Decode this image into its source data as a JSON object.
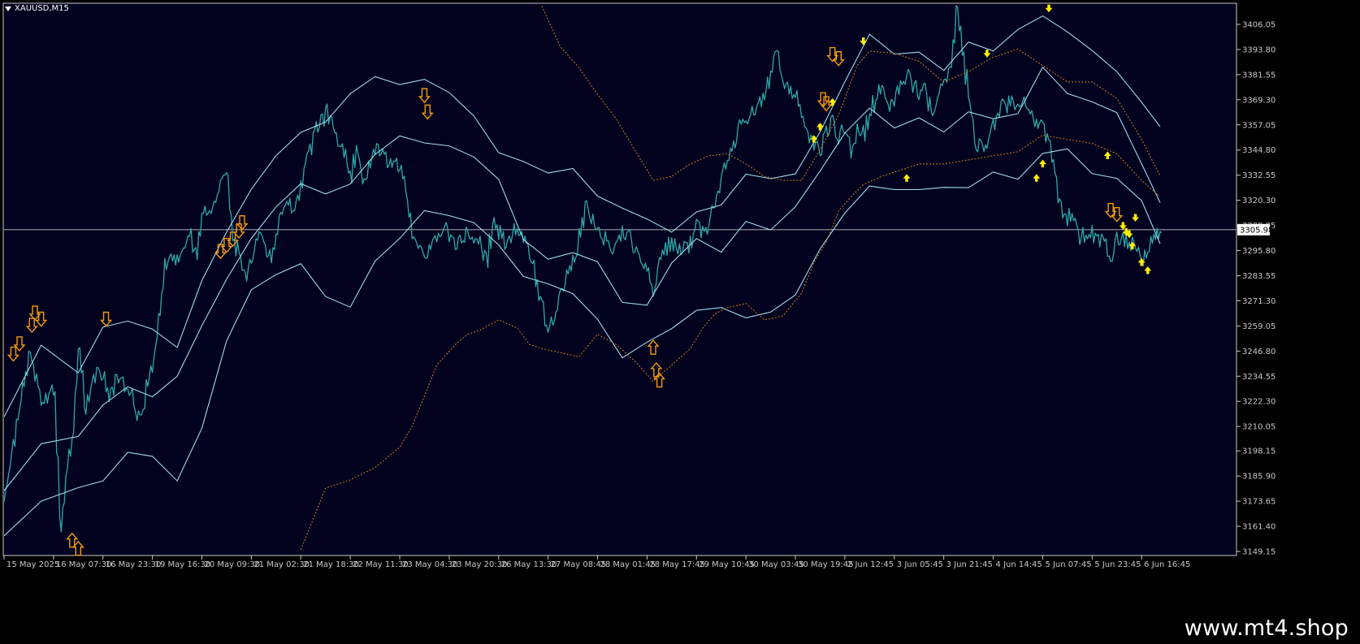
{
  "window": {
    "symbol_label": "XAUUSD,M15"
  },
  "watermark": "www.mt4.shop",
  "colors": {
    "background": "#000000",
    "plot_bg": "#02021f",
    "axis": "#c8c8c8",
    "price_line": "#2ea8a8",
    "band": "#9fdcec",
    "dotted": "#d27c12",
    "arrow_orange": "#f59a0c",
    "arrow_yellow": "#ffee00",
    "hline": "#c8c8c8"
  },
  "chart_data": {
    "type": "line",
    "title": "XAUUSD,M15",
    "ylim": [
      3146,
      3415
    ],
    "y_ticks": [
      "3406.05",
      "3393.80",
      "3381.55",
      "3369.30",
      "3357.05",
      "3344.80",
      "3332.55",
      "3320.30",
      "3308.05",
      "3295.80",
      "3283.55",
      "3271.30",
      "3259.05",
      "3246.80",
      "3234.55",
      "3222.30",
      "3210.05",
      "3198.15",
      "3185.90",
      "3173.65",
      "3161.40",
      "3149.15"
    ],
    "current_price": "3305.98",
    "x_ticks": [
      "15 May 2025",
      "16 May 07:30",
      "16 May 23:30",
      "19 May 16:30",
      "20 May 09:30",
      "21 May 02:30",
      "21 May 18:30",
      "22 May 11:30",
      "23 May 04:30",
      "23 May 20:30",
      "26 May 13:30",
      "27 May 08:45",
      "28 May 01:45",
      "28 May 17:45",
      "29 May 10:45",
      "30 May 03:45",
      "30 May 19:45",
      "2 Jun 12:45",
      "3 Jun 05:45",
      "3 Jun 21:45",
      "4 Jun 14:45",
      "5 Jun 07:45",
      "5 Jun 23:45",
      "6 Jun 16:45"
    ],
    "x_tick_index": [
      0,
      16,
      32,
      48,
      64,
      80,
      96,
      112,
      128,
      144,
      160,
      176,
      192,
      208,
      224,
      240,
      256,
      272,
      288,
      304,
      320,
      336,
      352,
      368
    ],
    "n_points": 375,
    "series": [
      {
        "key": "price",
        "x": [
          0,
          8,
          12,
          16,
          18,
          20,
          22,
          24,
          26,
          30,
          34,
          36,
          40,
          44,
          46,
          48,
          52,
          58,
          60,
          62,
          64,
          68,
          72,
          74,
          78,
          82,
          86,
          90,
          94,
          96,
          100,
          104,
          108,
          112,
          114,
          116,
          120,
          124,
          128,
          130,
          132,
          134,
          136,
          140,
          142,
          146,
          150,
          154,
          156,
          158,
          162,
          166,
          170,
          172,
          176,
          180,
          184,
          188,
          192,
          196,
          200,
          204,
          208,
          210,
          212,
          216,
          220,
          224,
          226,
          230,
          234,
          238,
          242,
          246,
          248,
          250,
          252,
          256,
          258,
          260,
          264,
          266,
          268,
          270,
          272,
          274,
          276,
          278,
          280,
          284,
          286,
          288,
          292,
          296,
          298,
          300,
          302,
          306,
          308,
          312,
          314,
          318,
          320,
          322,
          326,
          330,
          332,
          336,
          338,
          340,
          342,
          344,
          346,
          348,
          350,
          354,
          358,
          360,
          364,
          366,
          368,
          370,
          372,
          374
        ],
        "y": [
          3176,
          3247,
          3222,
          3228,
          3163,
          3185,
          3205,
          3248,
          3218,
          3239,
          3226,
          3232,
          3228,
          3212,
          3232,
          3240,
          3288,
          3296,
          3304,
          3294,
          3312,
          3320,
          3333,
          3300,
          3283,
          3305,
          3293,
          3316,
          3318,
          3330,
          3351,
          3364,
          3350,
          3332,
          3345,
          3331,
          3346,
          3339,
          3338,
          3322,
          3305,
          3298,
          3293,
          3302,
          3308,
          3297,
          3306,
          3300,
          3290,
          3310,
          3300,
          3307,
          3294,
          3280,
          3255,
          3275,
          3290,
          3317,
          3308,
          3296,
          3306,
          3297,
          3289,
          3276,
          3293,
          3300,
          3296,
          3307,
          3304,
          3320,
          3342,
          3356,
          3365,
          3370,
          3387,
          3391,
          3378,
          3372,
          3364,
          3350,
          3345,
          3356,
          3358,
          3350,
          3356,
          3345,
          3357,
          3353,
          3365,
          3375,
          3367,
          3370,
          3382,
          3372,
          3375,
          3360,
          3370,
          3385,
          3412,
          3370,
          3345,
          3349,
          3357,
          3365,
          3368,
          3370,
          3360,
          3357,
          3346,
          3330,
          3316,
          3312,
          3308,
          3302,
          3306,
          3302,
          3294,
          3302,
          3300,
          3296,
          3292,
          3298,
          3300,
          3305
        ]
      },
      {
        "key": "band_upper",
        "x": [
          0,
          12,
          24,
          32,
          40,
          48,
          56,
          64,
          72,
          80,
          88,
          96,
          104,
          112,
          120,
          128,
          136,
          144,
          152,
          160,
          168,
          176,
          184,
          192,
          200,
          208,
          216,
          224,
          232,
          240,
          248,
          256,
          264,
          272,
          280,
          288,
          296,
          304,
          312,
          320,
          328,
          336,
          344,
          352,
          360,
          368,
          374
        ],
        "y": [
          3216,
          3248,
          3236,
          3260,
          3262,
          3258,
          3250,
          3282,
          3303,
          3324,
          3342,
          3352,
          3360,
          3374,
          3380,
          3375,
          3378,
          3372,
          3360,
          3345,
          3338,
          3332,
          3336,
          3322,
          3318,
          3310,
          3305,
          3313,
          3320,
          3333,
          3330,
          3334,
          3352,
          3378,
          3402,
          3392,
          3392,
          3385,
          3398,
          3395,
          3405,
          3410,
          3402,
          3395,
          3382,
          3370,
          3357
        ]
      },
      {
        "key": "band_mid",
        "x": [
          0,
          12,
          24,
          32,
          40,
          48,
          56,
          64,
          72,
          80,
          88,
          96,
          104,
          112,
          120,
          128,
          136,
          144,
          152,
          160,
          168,
          176,
          184,
          192,
          200,
          208,
          216,
          224,
          232,
          240,
          248,
          256,
          264,
          272,
          280,
          288,
          296,
          304,
          312,
          320,
          328,
          336,
          344,
          352,
          360,
          368,
          374
        ],
        "y": [
          3180,
          3200,
          3205,
          3222,
          3230,
          3225,
          3236,
          3260,
          3280,
          3300,
          3317,
          3327,
          3325,
          3330,
          3342,
          3350,
          3347,
          3346,
          3340,
          3332,
          3300,
          3290,
          3295,
          3290,
          3272,
          3268,
          3290,
          3300,
          3297,
          3310,
          3305,
          3318,
          3333,
          3353,
          3366,
          3356,
          3360,
          3355,
          3364,
          3362,
          3364,
          3385,
          3372,
          3370,
          3362,
          3340,
          3320
        ]
      },
      {
        "key": "band_lower",
        "x": [
          0,
          12,
          24,
          32,
          40,
          48,
          56,
          64,
          72,
          80,
          88,
          96,
          104,
          112,
          120,
          128,
          136,
          144,
          152,
          160,
          168,
          176,
          184,
          192,
          200,
          208,
          216,
          224,
          232,
          240,
          248,
          256,
          264,
          272,
          280,
          288,
          296,
          304,
          312,
          320,
          328,
          336,
          344,
          352,
          360,
          368,
          374
        ],
        "y": [
          3158,
          3172,
          3180,
          3185,
          3198,
          3196,
          3185,
          3210,
          3250,
          3275,
          3284,
          3288,
          3275,
          3270,
          3290,
          3300,
          3314,
          3312,
          3308,
          3300,
          3282,
          3278,
          3275,
          3262,
          3245,
          3250,
          3258,
          3265,
          3270,
          3263,
          3265,
          3275,
          3295,
          3314,
          3328,
          3326,
          3325,
          3328,
          3327,
          3336,
          3332,
          3343,
          3345,
          3335,
          3330,
          3322,
          3300
        ]
      },
      {
        "key": "dotted_upper",
        "x": [
          174,
          180,
          186,
          192,
          198,
          204,
          210,
          216,
          222,
          228,
          234,
          240,
          246,
          252,
          258,
          264,
          270,
          276,
          280,
          288,
          296,
          304,
          312,
          320,
          328,
          336,
          344,
          352,
          360,
          368,
          374
        ],
        "y": [
          3415,
          3395,
          3385,
          3372,
          3360,
          3345,
          3330,
          3332,
          3338,
          3342,
          3343,
          3338,
          3332,
          3330,
          3330,
          3345,
          3362,
          3386,
          3393,
          3392,
          3388,
          3378,
          3383,
          3390,
          3394,
          3386,
          3378,
          3378,
          3370,
          3350,
          3332
        ]
      },
      {
        "key": "dotted_lower",
        "x": [
          96,
          104,
          112,
          120,
          128,
          132,
          136,
          140,
          146,
          150,
          154,
          160,
          166,
          170,
          174,
          180,
          186,
          192,
          198,
          204,
          210,
          216,
          222,
          226,
          230,
          234,
          240,
          246,
          252,
          258,
          262,
          266,
          270,
          274,
          278,
          284,
          290,
          296,
          304,
          312,
          320,
          328,
          336,
          344,
          352,
          360,
          368,
          374
        ],
        "y": [
          3150,
          3180,
          3184,
          3190,
          3200,
          3210,
          3225,
          3240,
          3250,
          3255,
          3257,
          3262,
          3258,
          3250,
          3248,
          3246,
          3244,
          3255,
          3250,
          3242,
          3232,
          3240,
          3248,
          3258,
          3265,
          3268,
          3270,
          3262,
          3264,
          3275,
          3290,
          3300,
          3315,
          3322,
          3328,
          3332,
          3335,
          3338,
          3338,
          3340,
          3342,
          3344,
          3352,
          3350,
          3348,
          3343,
          3330,
          3322
        ]
      }
    ],
    "arrows_up_orange": [
      [
        22,
        3158
      ],
      [
        24,
        3154
      ],
      [
        210,
        3252
      ],
      [
        211,
        3241
      ],
      [
        212,
        3236
      ]
    ],
    "arrows_down_orange": [
      [
        3,
        3242
      ],
      [
        5,
        3247
      ],
      [
        9,
        3256
      ],
      [
        10,
        3262
      ],
      [
        12,
        3259
      ],
      [
        33,
        3259
      ],
      [
        70,
        3292
      ],
      [
        72,
        3295
      ],
      [
        74,
        3298
      ],
      [
        76,
        3302
      ],
      [
        77,
        3306
      ],
      [
        136,
        3368
      ],
      [
        137,
        3360
      ],
      [
        265,
        3366
      ],
      [
        266,
        3364
      ],
      [
        268,
        3388
      ],
      [
        270,
        3386
      ],
      [
        358,
        3312
      ],
      [
        360,
        3310
      ]
    ],
    "arrows_up_yellow": [
      [
        262,
        3352
      ],
      [
        264,
        3358
      ],
      [
        268,
        3370
      ],
      [
        292,
        3333
      ],
      [
        334,
        3333
      ],
      [
        336,
        3340
      ],
      [
        357,
        3344
      ],
      [
        365,
        3300
      ],
      [
        368,
        3292
      ],
      [
        370,
        3288
      ]
    ],
    "arrows_down_yellow": [
      [
        278,
        3396
      ],
      [
        318,
        3390
      ],
      [
        338,
        3412
      ],
      [
        362,
        3306
      ],
      [
        363,
        3303
      ],
      [
        364,
        3302
      ],
      [
        366,
        3310
      ]
    ]
  }
}
